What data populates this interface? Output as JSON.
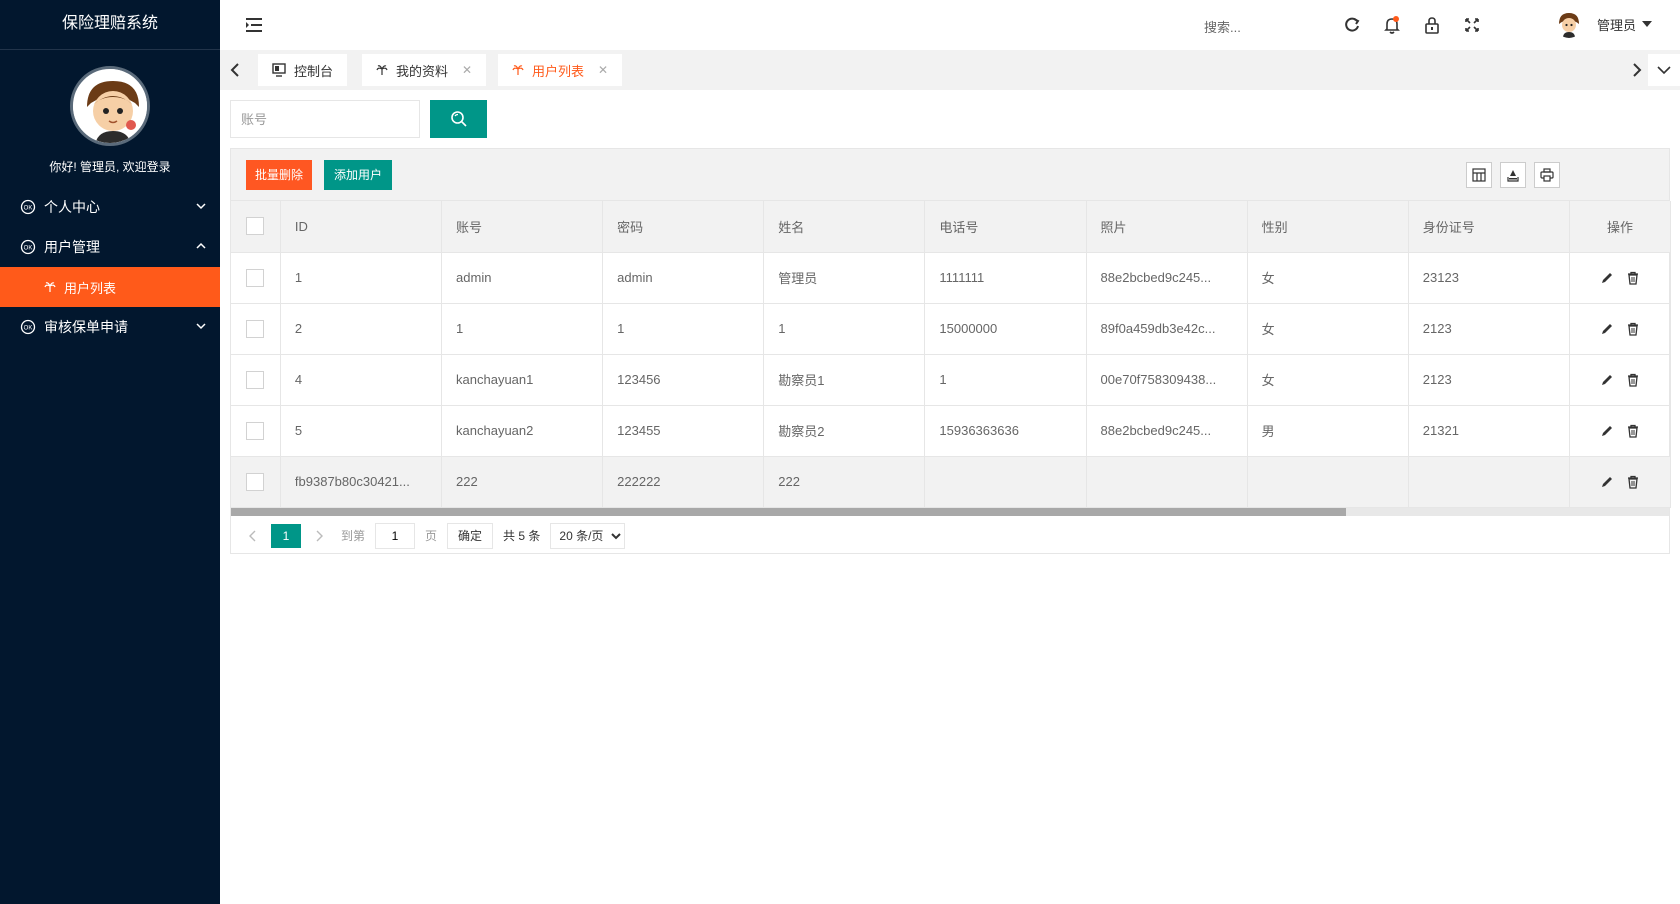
{
  "app": {
    "title": "保险理赔系统",
    "welcome": "你好! 管理员, 欢迎登录"
  },
  "sidebar": {
    "items": [
      {
        "label": "个人中心",
        "expanded": false
      },
      {
        "label": "用户管理",
        "expanded": true
      },
      {
        "label": "审核保单申请",
        "expanded": false
      }
    ],
    "sub_active": "用户列表"
  },
  "header": {
    "search_label": "搜索...",
    "user_name": "管理员"
  },
  "tabs": [
    {
      "label": "控制台",
      "icon": "monitor-icon",
      "closable": false,
      "active": false
    },
    {
      "label": "我的资料",
      "icon": "palm-icon",
      "closable": true,
      "active": false
    },
    {
      "label": "用户列表",
      "icon": "palm-icon",
      "closable": true,
      "active": true
    }
  ],
  "search": {
    "placeholder": "账号"
  },
  "toolbar": {
    "batch_delete_label": "批量删除",
    "add_label": "添加用户"
  },
  "table": {
    "columns": [
      "ID",
      "账号",
      "密码",
      "姓名",
      "电话号",
      "照片",
      "性别",
      "身份证号",
      "操作"
    ],
    "rows": [
      {
        "id": "1",
        "account": "admin",
        "password": "admin",
        "name": "管理员",
        "phone": "1111111",
        "photo": "88e2bcbed9c245...",
        "gender": "女",
        "idcard": "23123"
      },
      {
        "id": "2",
        "account": "1",
        "password": "1",
        "name": "1",
        "phone": "15000000",
        "photo": "89f0a459db3e42c...",
        "gender": "女",
        "idcard": "2123"
      },
      {
        "id": "4",
        "account": "kanchayuan1",
        "password": "123456",
        "name": "勘察员1",
        "phone": "1",
        "photo": "00e70f758309438...",
        "gender": "女",
        "idcard": "2123"
      },
      {
        "id": "5",
        "account": "kanchayuan2",
        "password": "123455",
        "name": "勘察员2",
        "phone": "15936363636",
        "photo": "88e2bcbed9c245...",
        "gender": "男",
        "idcard": "21321"
      },
      {
        "id": "fb9387b80c30421...",
        "account": "222",
        "password": "222222",
        "name": "222",
        "phone": "",
        "photo": "",
        "gender": "",
        "idcard": ""
      }
    ]
  },
  "pager": {
    "current": "1",
    "goto_label": "到第",
    "goto_value": "1",
    "page_label": "页",
    "ok_label": "确定",
    "count_label": "共 5 条",
    "size_label": "20 条/页"
  },
  "colors": {
    "sidebar_bg": "#02172e",
    "accent_orange": "#ff5a1a",
    "accent_teal": "#009688"
  }
}
